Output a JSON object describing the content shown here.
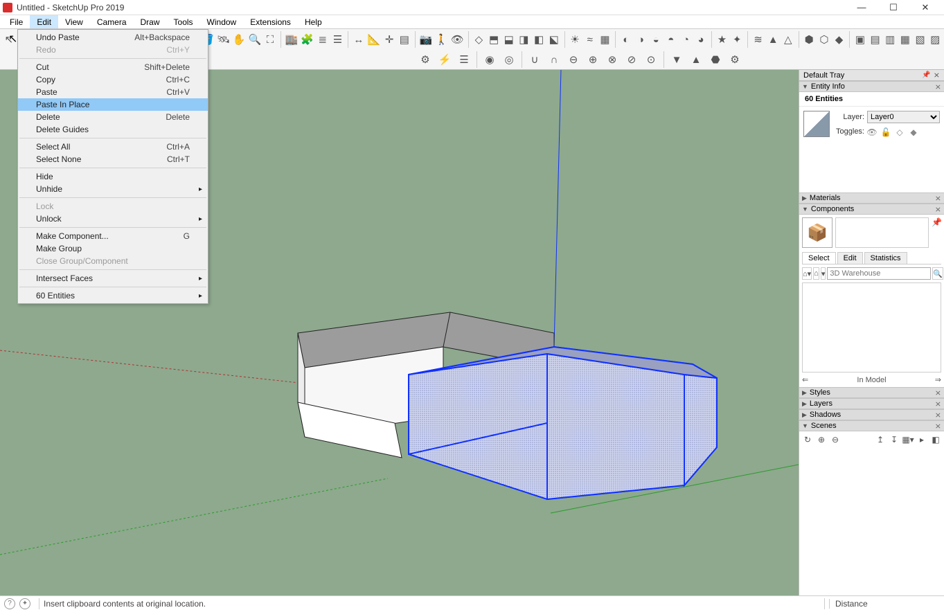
{
  "window": {
    "title": "Untitled - SketchUp Pro 2019"
  },
  "menubar": [
    "File",
    "Edit",
    "View",
    "Camera",
    "Draw",
    "Tools",
    "Window",
    "Extensions",
    "Help"
  ],
  "menubar_active": "Edit",
  "edit_menu": [
    {
      "label": "Undo Paste",
      "shortcut": "Alt+Backspace",
      "type": "item"
    },
    {
      "label": "Redo",
      "shortcut": "Ctrl+Y",
      "type": "item",
      "disabled": true
    },
    {
      "type": "sep"
    },
    {
      "label": "Cut",
      "shortcut": "Shift+Delete",
      "type": "item"
    },
    {
      "label": "Copy",
      "shortcut": "Ctrl+C",
      "type": "item"
    },
    {
      "label": "Paste",
      "shortcut": "Ctrl+V",
      "type": "item"
    },
    {
      "label": "Paste In Place",
      "shortcut": "",
      "type": "item",
      "highlighted": true
    },
    {
      "label": "Delete",
      "shortcut": "Delete",
      "type": "item"
    },
    {
      "label": "Delete Guides",
      "shortcut": "",
      "type": "item"
    },
    {
      "type": "sep"
    },
    {
      "label": "Select All",
      "shortcut": "Ctrl+A",
      "type": "item"
    },
    {
      "label": "Select None",
      "shortcut": "Ctrl+T",
      "type": "item"
    },
    {
      "type": "sep"
    },
    {
      "label": "Hide",
      "shortcut": "",
      "type": "item"
    },
    {
      "label": "Unhide",
      "shortcut": "",
      "type": "item",
      "submenu": true
    },
    {
      "type": "sep"
    },
    {
      "label": "Lock",
      "shortcut": "",
      "type": "item",
      "disabled": true
    },
    {
      "label": "Unlock",
      "shortcut": "",
      "type": "item",
      "submenu": true
    },
    {
      "type": "sep"
    },
    {
      "label": "Make Component...",
      "shortcut": "G",
      "type": "item"
    },
    {
      "label": "Make Group",
      "shortcut": "",
      "type": "item"
    },
    {
      "label": "Close Group/Component",
      "shortcut": "",
      "type": "item",
      "disabled": true
    },
    {
      "type": "sep"
    },
    {
      "label": "Intersect Faces",
      "shortcut": "",
      "type": "item",
      "submenu": true
    },
    {
      "type": "sep"
    },
    {
      "label": "60 Entities",
      "shortcut": "",
      "type": "item",
      "submenu": true
    }
  ],
  "tray": {
    "header": "Default Tray",
    "entity_info": {
      "title": "Entity Info",
      "count_label": "60 Entities",
      "layer_label": "Layer:",
      "layer_value": "Layer0",
      "toggles_label": "Toggles:"
    },
    "materials": {
      "title": "Materials"
    },
    "components": {
      "title": "Components",
      "tabs": [
        "Select",
        "Edit",
        "Statistics"
      ],
      "active_tab": "Select",
      "search_placeholder": "3D Warehouse",
      "nav_label": "In Model"
    },
    "styles": {
      "title": "Styles"
    },
    "layers": {
      "title": "Layers"
    },
    "shadows": {
      "title": "Shadows"
    },
    "scenes": {
      "title": "Scenes"
    }
  },
  "statusbar": {
    "message": "Insert clipboard contents at original location.",
    "distance_label": "Distance"
  },
  "toolbar_icons_row1": [
    "select",
    "eraser",
    "line",
    "arc",
    "rect",
    "circle",
    "pushpull",
    "offset",
    "move",
    "rotate",
    "scale",
    "tape",
    "text",
    "paint",
    "orbit",
    "pan",
    "zoom",
    "zoom-extents",
    "sep",
    "warehouse",
    "extensions",
    "layers",
    "outliner",
    "sep",
    "dim",
    "protractor",
    "axes",
    "section",
    "sep",
    "position-camera",
    "walk",
    "look",
    "sep",
    "iso",
    "top",
    "front",
    "right",
    "back",
    "left",
    "sep",
    "shadows",
    "fog",
    "xray",
    "sep",
    "styles1",
    "styles2",
    "styles3",
    "styles4",
    "styles5",
    "styles6",
    "sep",
    "render1",
    "render2",
    "sep",
    "sandbox1",
    "sandbox2",
    "sandbox3",
    "sep",
    "solid1",
    "solid2",
    "solid3",
    "sep",
    "views1",
    "views2",
    "views3",
    "views4",
    "views5",
    "views6"
  ],
  "toolbar_icons_row2": [
    "dyn1",
    "dyn2",
    "dyn3",
    "sep",
    "solid-a",
    "solid-b",
    "sep",
    "bool1",
    "bool2",
    "bool3",
    "bool4",
    "bool5",
    "bool6",
    "bool7",
    "sep",
    "ext1",
    "ext2",
    "ext3",
    "ext4"
  ],
  "colors": {
    "highlight": "#91c9f7",
    "selection_blue": "#1030ff",
    "ground": "#8ea98e"
  }
}
